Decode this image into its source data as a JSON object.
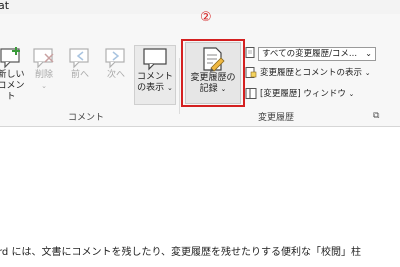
{
  "ribbon_tab": {
    "label": "at"
  },
  "annotation": {
    "number": "②",
    "color": "#d42020"
  },
  "comment_group": {
    "label": "コメント",
    "new_comment": "新しい\nコメント",
    "delete": "削除",
    "previous": "前へ",
    "next": "次へ",
    "show_comments": "コメント\nの表示"
  },
  "tracking_group": {
    "label": "変更履歴",
    "track_changes": "変更履歴の\n記録",
    "markup_dropdown": "すべての変更履歴/コメ...",
    "show_markup": "変更履歴とコメントの表示",
    "reviewing_pane": "[変更履歴] ウィンドウ"
  },
  "document": {
    "text": "rd には、文書にコメントを残したり、変更履歴を残せたりする便利な「校閲」柱"
  }
}
